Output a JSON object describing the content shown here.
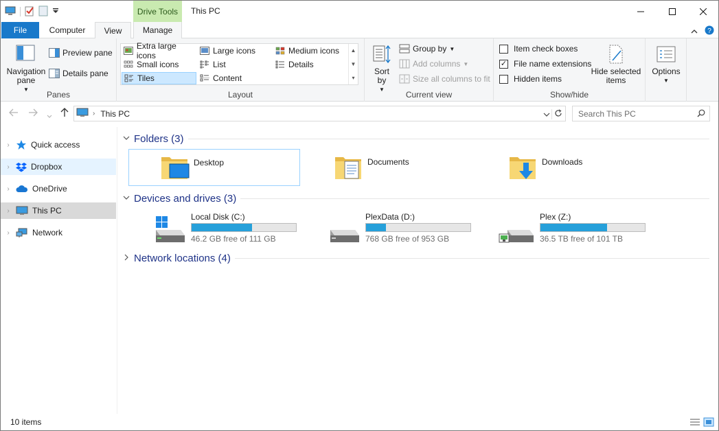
{
  "window": {
    "title": "This PC",
    "context_tab": "Drive Tools"
  },
  "tabs": {
    "file": "File",
    "computer": "Computer",
    "view": "View",
    "manage": "Manage"
  },
  "ribbon": {
    "panes": {
      "label": "Panes",
      "navigation_pane": "Navigation pane",
      "preview_pane": "Preview pane",
      "details_pane": "Details pane"
    },
    "layout": {
      "label": "Layout",
      "items": [
        "Extra large icons",
        "Large icons",
        "Medium icons",
        "Small icons",
        "List",
        "Details",
        "Tiles",
        "Content"
      ],
      "selected": "Tiles"
    },
    "current_view": {
      "label": "Current view",
      "sort_by": "Sort by",
      "group_by": "Group by",
      "add_columns": "Add columns",
      "size_columns": "Size all columns to fit"
    },
    "show_hide": {
      "label": "Show/hide",
      "item_check_boxes": "Item check boxes",
      "file_name_extensions": "File name extensions",
      "hidden_items": "Hidden items",
      "item_check_boxes_checked": false,
      "file_name_extensions_checked": true,
      "hidden_items_checked": false,
      "hide_selected": "Hide selected items"
    },
    "options": "Options"
  },
  "address": {
    "path": "This PC",
    "search_placeholder": "Search This PC"
  },
  "nav": {
    "items": [
      {
        "label": "Quick access"
      },
      {
        "label": "Dropbox"
      },
      {
        "label": "OneDrive"
      },
      {
        "label": "This PC"
      },
      {
        "label": "Network"
      }
    ]
  },
  "content": {
    "folders_title": "Folders (3)",
    "folders": [
      {
        "name": "Desktop"
      },
      {
        "name": "Documents"
      },
      {
        "name": "Downloads"
      }
    ],
    "devices_title": "Devices and drives (3)",
    "drives": [
      {
        "name": "Local Disk (C:)",
        "free": "46.2 GB free of 111 GB",
        "used_fraction": 0.58
      },
      {
        "name": "PlexData (D:)",
        "free": "768 GB free of 953 GB",
        "used_fraction": 0.19
      },
      {
        "name": "Plex (Z:)",
        "free": "36.5 TB free of 101 TB",
        "used_fraction": 0.64
      }
    ],
    "network_title": "Network locations (4)"
  },
  "status": {
    "count": "10 items"
  },
  "colors": {
    "accent": "#1979ca",
    "drive_bar": "#26a0da",
    "section_title": "#1e3287",
    "context_tab": "#c9eab0"
  }
}
